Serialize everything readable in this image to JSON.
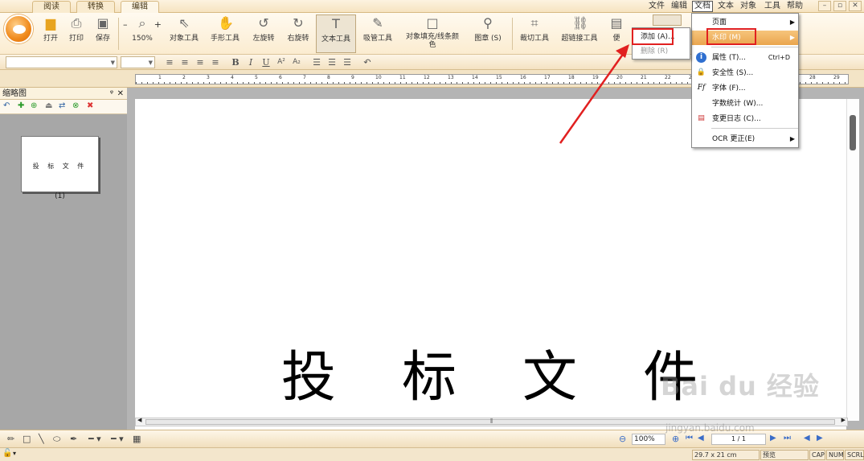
{
  "tabs": [
    {
      "label": "阅读"
    },
    {
      "label": "转换"
    },
    {
      "label": "编辑"
    }
  ],
  "menus": [
    {
      "label": "文件"
    },
    {
      "label": "编辑"
    },
    {
      "label": "文档"
    },
    {
      "label": "文本"
    },
    {
      "label": "对象"
    },
    {
      "label": "工具"
    },
    {
      "label": "帮助"
    }
  ],
  "window_controls": {
    "minimize": "–",
    "restore": "▫",
    "close": "✕"
  },
  "toolbar": {
    "open": "打开",
    "print": "打印",
    "save": "保存",
    "zoom": "150%",
    "zoom_minus": "–",
    "zoom_plus": "+",
    "object_tool": "对象工具",
    "hand_tool": "手形工具",
    "rotate_left": "左旋转",
    "rotate_right": "右旋转",
    "text_tool": "文本工具",
    "pipe_tool": "吸管工具",
    "fill_line_1": "对象填充/线条颜",
    "fill_line_2": "色",
    "stamp": "图章 (S)",
    "crop_tool": "裁切工具",
    "link_tool": "超链接工具",
    "partial": "便"
  },
  "format_bar": {
    "bold": "B",
    "italic": "I",
    "underline": "U",
    "superscript": "A²",
    "subscript": "A₂"
  },
  "ruler": {
    "numbers": [
      "1",
      "2",
      "3",
      "4",
      "5",
      "6",
      "7",
      "8",
      "9",
      "10",
      "11",
      "12",
      "13",
      "14",
      "15",
      "16",
      "17",
      "18",
      "19",
      "20",
      "21",
      "22",
      "23",
      "24",
      "25",
      "26",
      "27",
      "28",
      "29"
    ]
  },
  "thumbnail_panel": {
    "title": "缩略图",
    "pin": "ᵠ",
    "close": "✕",
    "page_text": "投 标 文 件",
    "page_caption": "(1)"
  },
  "document": {
    "title_text": "投标文件"
  },
  "document_menu": {
    "items": [
      {
        "label": "页面",
        "shortcut": "",
        "has_submenu": true
      },
      {
        "label": "水印 (M)",
        "shortcut": "",
        "has_submenu": true
      },
      {
        "label": "属性 (T)...",
        "shortcut": "Ctrl+D",
        "has_submenu": false
      },
      {
        "label": "安全性 (S)...",
        "shortcut": "",
        "has_submenu": false
      },
      {
        "label": "字体 (F)...",
        "shortcut": "",
        "has_submenu": false
      },
      {
        "label": "字数统计 (W)...",
        "shortcut": "",
        "has_submenu": false
      },
      {
        "label": "变更日志 (C)...",
        "shortcut": "",
        "has_submenu": false
      },
      {
        "label": "OCR 更正(E)",
        "shortcut": "",
        "has_submenu": true
      }
    ],
    "highlighted": "水印 (M)"
  },
  "watermark_submenu": {
    "items": [
      {
        "label": "添加 (A)...",
        "enabled": true
      },
      {
        "label": "删除 (R)",
        "enabled": false
      }
    ]
  },
  "bottom_toolbar": {
    "zoom": "100%",
    "page": "1 / 1"
  },
  "status_bar": {
    "page_size": "29.7 x 21 cm",
    "mode": "预览",
    "cap": "CAP",
    "num": "NUM",
    "scrl": "SCRL"
  },
  "watermark_overlay": {
    "brand": "Bai du 经验",
    "url": "jingyan.baidu.com"
  },
  "colors": {
    "accent": "#f0a040",
    "highlight_box": "#e12020"
  }
}
